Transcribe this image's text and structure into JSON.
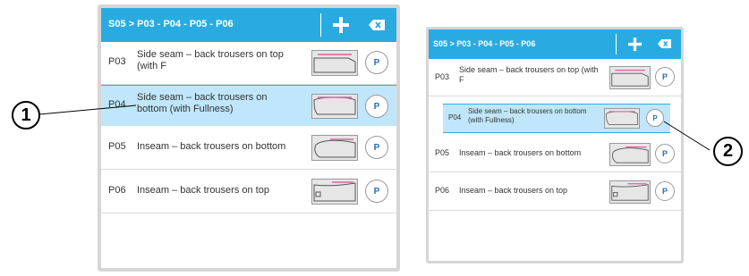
{
  "left_panel": {
    "breadcrumb": "S05 > P03 - P04 - P05 - P06",
    "rows": [
      {
        "code": "P03",
        "label": "Side seam – back trousers on top (with F",
        "button": "P"
      },
      {
        "code": "P04",
        "label": "Side seam – back trousers on bottom (with Fullness)",
        "button": "P",
        "selected": true
      },
      {
        "code": "P05",
        "label": "Inseam – back trousers on bottom",
        "button": "P"
      },
      {
        "code": "P06",
        "label": "Inseam – back trousers on top",
        "button": "P"
      }
    ]
  },
  "right_panel": {
    "breadcrumb": "S05 > P03 - P04 - P05 - P06",
    "rows": [
      {
        "code": "P03",
        "label": "Side seam – back trousers on top (with F",
        "button": "P"
      },
      {
        "code": "P04",
        "label": "Side seam – back trousers on bottom (with Fullness)",
        "button": "P",
        "selected": true
      },
      {
        "code": "P05",
        "label": "Inseam – back trousers on bottom",
        "button": "P"
      },
      {
        "code": "P06",
        "label": "Inseam – back trousers on top",
        "button": "P"
      }
    ]
  },
  "callouts": {
    "one": "1",
    "two": "2"
  },
  "colors": {
    "header": "#29abe2",
    "selected_row": "#bfe6fa"
  },
  "icons": {
    "add": "plus-icon",
    "delete": "backspace-icon"
  }
}
